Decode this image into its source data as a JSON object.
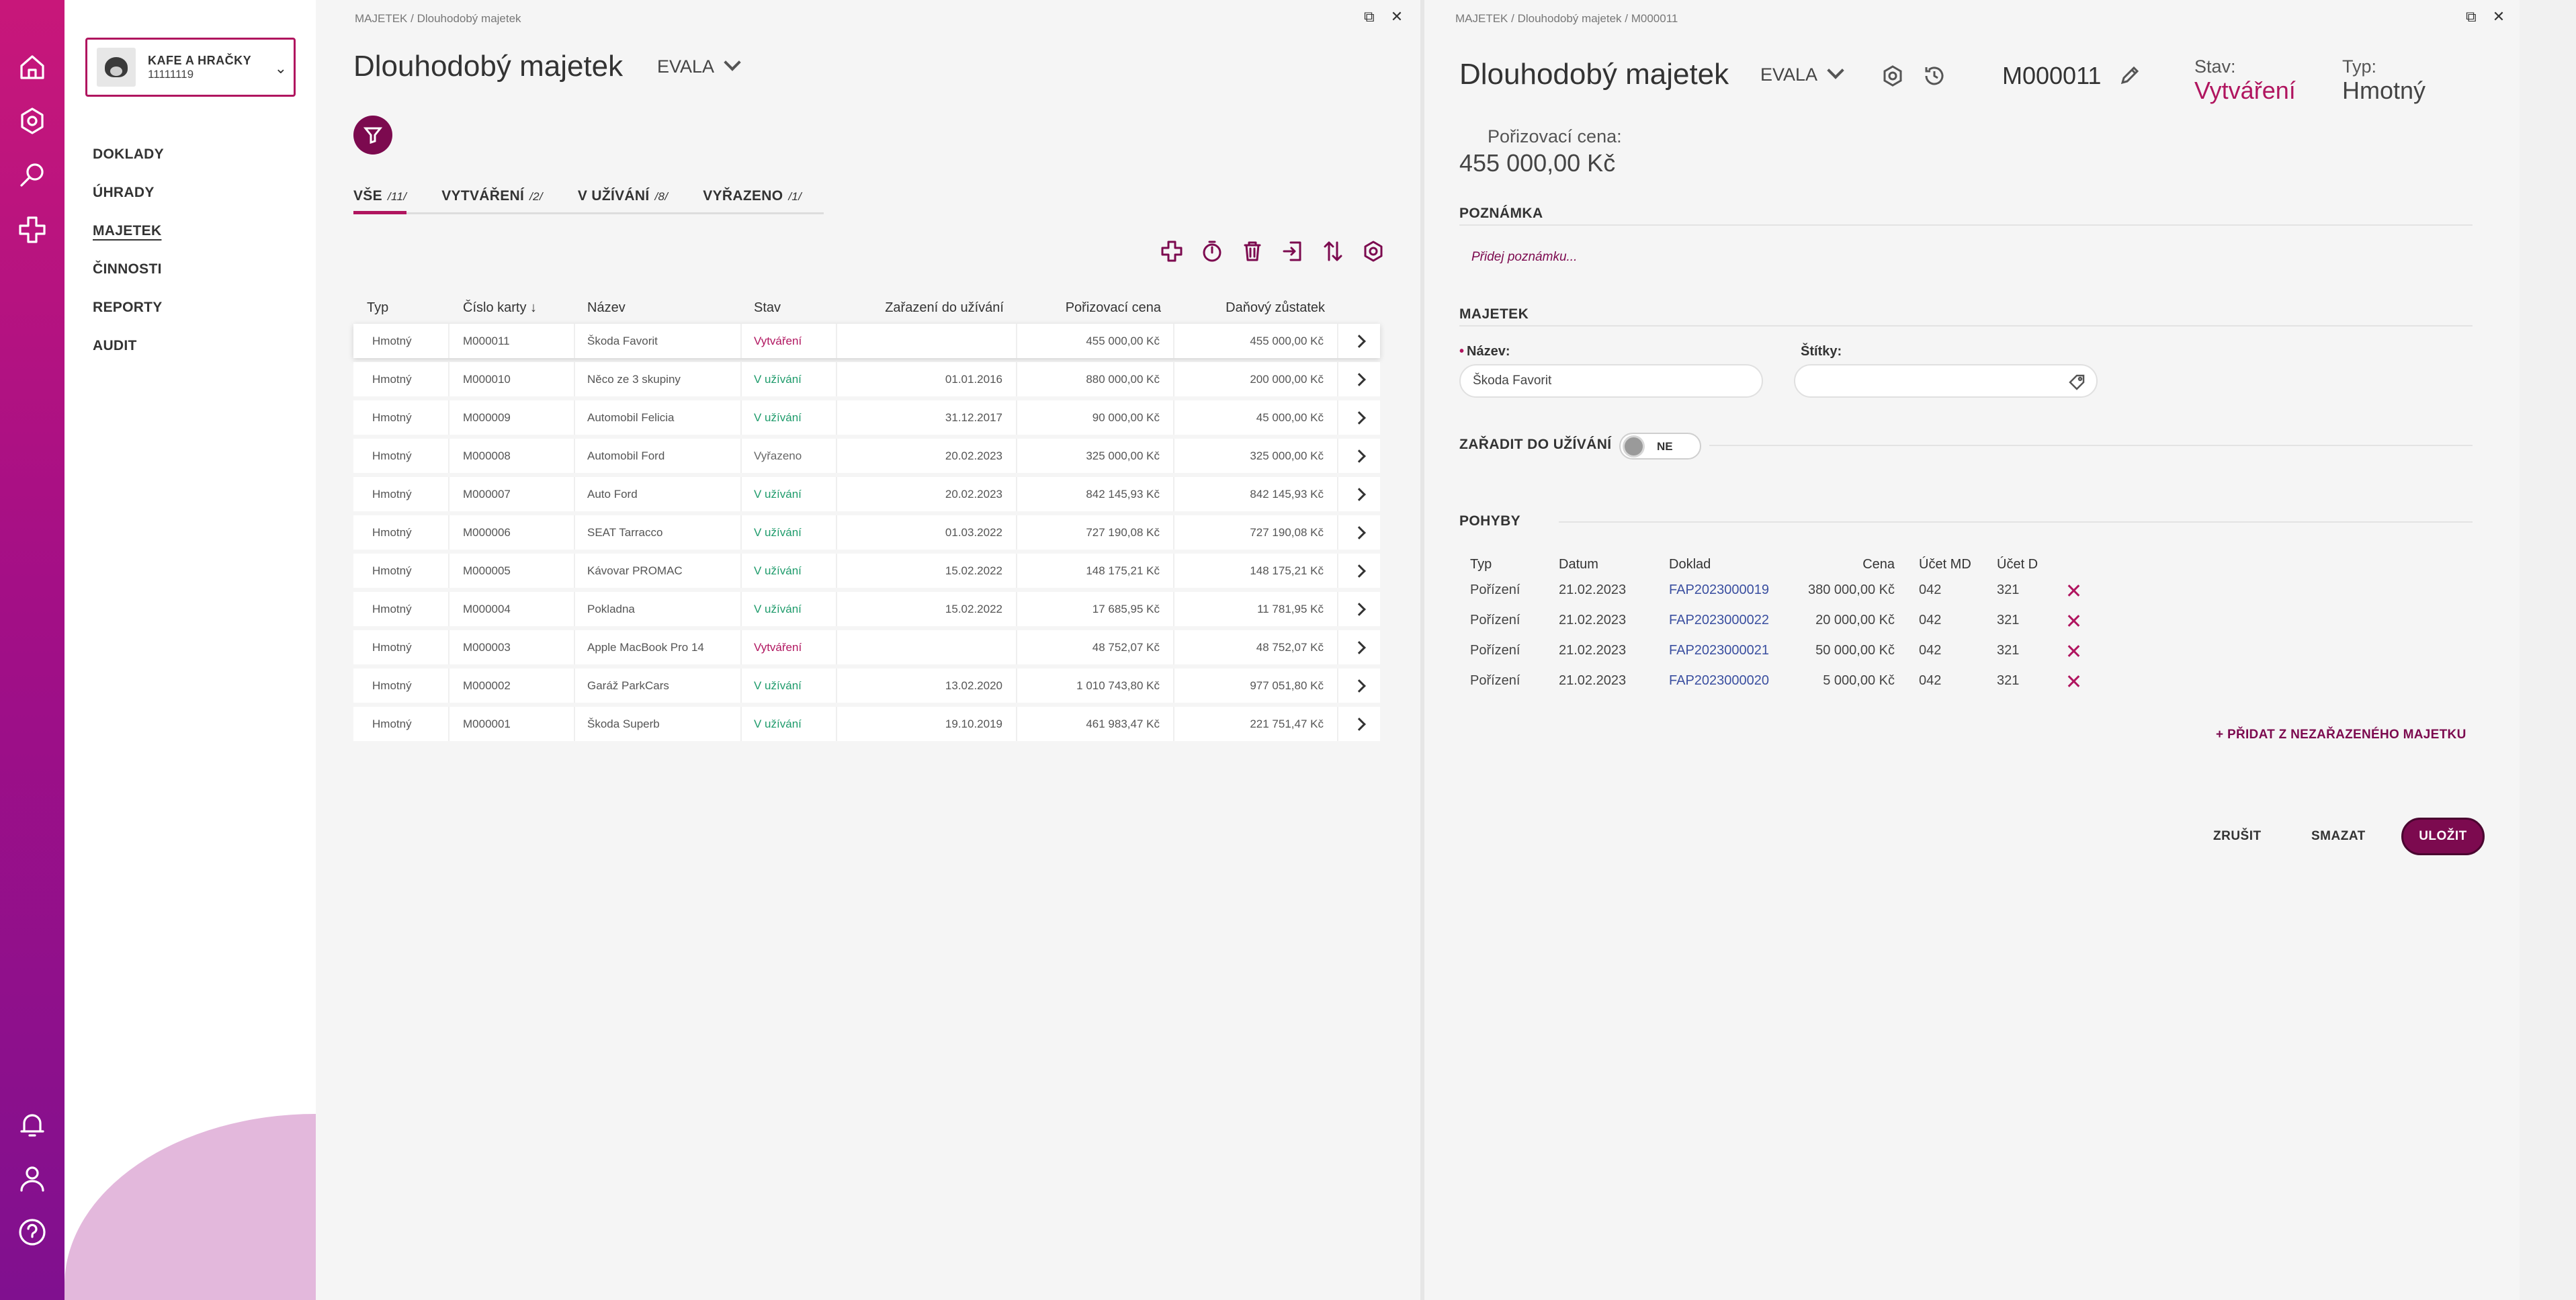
{
  "rail": {
    "icons": [
      "home-icon",
      "settings-icon",
      "search-icon",
      "plus-cross-icon",
      "bell-icon",
      "user-icon",
      "help-icon"
    ]
  },
  "company": {
    "name": "KAFE A HRAČKY",
    "id": "11111119"
  },
  "menu": [
    "DOKLADY",
    "ÚHRADY",
    "MAJETEK",
    "ČINNOSTI",
    "REPORTY",
    "AUDIT"
  ],
  "left": {
    "breadcrumb": "MAJETEK  /  Dlouhodobý majetek",
    "title": "Dlouhodobý majetek",
    "dropdown": "EVALA",
    "tabs": [
      {
        "label": "VŠE",
        "count": "/11/"
      },
      {
        "label": "VYTVÁŘENÍ",
        "count": "/2/"
      },
      {
        "label": "V UŽÍVÁNÍ",
        "count": "/8/"
      },
      {
        "label": "VYŘAZENO",
        "count": "/1/"
      }
    ],
    "columns": [
      "Typ",
      "Číslo karty ↓",
      "Název",
      "Stav",
      "Zařazení do užívání",
      "Pořizovací cena",
      "Daňový zůstatek"
    ],
    "rows": [
      {
        "typ": "Hmotný",
        "cislo": "M000011",
        "nazev": "Škoda Favorit",
        "stav": "Vytváření",
        "zarazeni": "",
        "cena": "455 000,00 Kč",
        "zustatek": "455 000,00 Kč"
      },
      {
        "typ": "Hmotný",
        "cislo": "M000010",
        "nazev": "Něco ze 3 skupiny",
        "stav": "V užívání",
        "zarazeni": "01.01.2016",
        "cena": "880 000,00 Kč",
        "zustatek": "200 000,00 Kč"
      },
      {
        "typ": "Hmotný",
        "cislo": "M000009",
        "nazev": "Automobil Felicia",
        "stav": "V užívání",
        "zarazeni": "31.12.2017",
        "cena": "90 000,00 Kč",
        "zustatek": "45 000,00 Kč"
      },
      {
        "typ": "Hmotný",
        "cislo": "M000008",
        "nazev": "Automobil Ford",
        "stav": "Vyřazeno",
        "zarazeni": "20.02.2023",
        "cena": "325 000,00 Kč",
        "zustatek": "325 000,00 Kč"
      },
      {
        "typ": "Hmotný",
        "cislo": "M000007",
        "nazev": "Auto Ford",
        "stav": "V užívání",
        "zarazeni": "20.02.2023",
        "cena": "842 145,93 Kč",
        "zustatek": "842 145,93 Kč"
      },
      {
        "typ": "Hmotný",
        "cislo": "M000006",
        "nazev": "SEAT Tarracco",
        "stav": "V užívání",
        "zarazeni": "01.03.2022",
        "cena": "727 190,08 Kč",
        "zustatek": "727 190,08 Kč"
      },
      {
        "typ": "Hmotný",
        "cislo": "M000005",
        "nazev": "Kávovar PROMAC",
        "stav": "V užívání",
        "zarazeni": "15.02.2022",
        "cena": "148 175,21 Kč",
        "zustatek": "148 175,21 Kč"
      },
      {
        "typ": "Hmotný",
        "cislo": "M000004",
        "nazev": "Pokladna",
        "stav": "V užívání",
        "zarazeni": "15.02.2022",
        "cena": "17 685,95 Kč",
        "zustatek": "11 781,95 Kč"
      },
      {
        "typ": "Hmotný",
        "cislo": "M000003",
        "nazev": "Apple MacBook Pro 14",
        "stav": "Vytváření",
        "zarazeni": "",
        "cena": "48 752,07 Kč",
        "zustatek": "48 752,07 Kč"
      },
      {
        "typ": "Hmotný",
        "cislo": "M000002",
        "nazev": "Garáž ParkCars",
        "stav": "V užívání",
        "zarazeni": "13.02.2020",
        "cena": "1 010 743,80 Kč",
        "zustatek": "977 051,80 Kč"
      },
      {
        "typ": "Hmotný",
        "cislo": "M000001",
        "nazev": "Škoda Superb",
        "stav": "V užívání",
        "zarazeni": "19.10.2019",
        "cena": "461 983,47 Kč",
        "zustatek": "221 751,47 Kč"
      }
    ]
  },
  "right": {
    "breadcrumb": "MAJETEK  /  Dlouhodobý majetek  /  M000011",
    "title": "Dlouhodobý majetek",
    "dropdown": "EVALA",
    "code": "M000011",
    "stav_label": "Stav:",
    "stav_value": "Vytváření",
    "typ_label": "Typ:",
    "typ_value": "Hmotný",
    "cena_label": "Pořizovací cena:",
    "cena_value": "455 000,00 Kč",
    "section_note": "POZNÁMKA",
    "note_placeholder": "Přidej poznámku...",
    "section_asset": "MAJETEK",
    "nazev_label": "Název:",
    "nazev_value": "Škoda Favorit",
    "stitky_label": "Štítky:",
    "zaradit_label": "ZAŘADIT DO UŽÍVÁNÍ",
    "toggle_label": "NE",
    "section_moves": "POHYBY",
    "moves_columns": [
      "Typ",
      "Datum",
      "Doklad",
      "Cena",
      "Účet MD",
      "Účet D"
    ],
    "moves": [
      {
        "typ": "Pořízení",
        "datum": "21.02.2023",
        "doklad": "FAP2023000019",
        "cena": "380 000,00 Kč",
        "md": "042",
        "d": "321"
      },
      {
        "typ": "Pořízení",
        "datum": "21.02.2023",
        "doklad": "FAP2023000022",
        "cena": "20 000,00 Kč",
        "md": "042",
        "d": "321"
      },
      {
        "typ": "Pořízení",
        "datum": "21.02.2023",
        "doklad": "FAP2023000021",
        "cena": "50 000,00 Kč",
        "md": "042",
        "d": "321"
      },
      {
        "typ": "Pořízení",
        "datum": "21.02.2023",
        "doklad": "FAP2023000020",
        "cena": "5 000,00 Kč",
        "md": "042",
        "d": "321"
      }
    ],
    "add_link": "+  PŘIDAT Z NEZAŘAZENÉHO MAJETKU",
    "btn_cancel": "ZRUŠIT",
    "btn_delete": "SMAZAT",
    "btn_save": "ULOŽIT"
  },
  "colors": {
    "accent": "#7c0a4f",
    "status_new": "#b0155f",
    "status_use": "#1e9b6b",
    "link": "#3a4fa0"
  }
}
